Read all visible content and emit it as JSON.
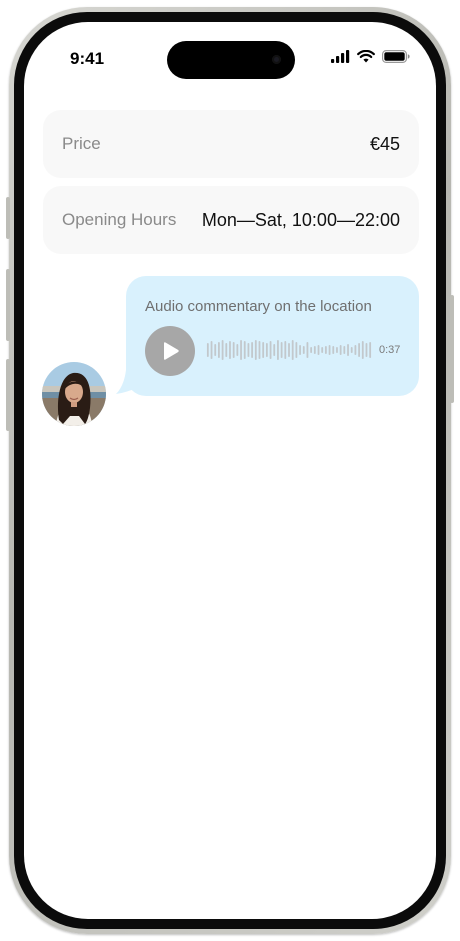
{
  "status_bar": {
    "time": "9:41"
  },
  "details": [
    {
      "label": "Price",
      "value": "€45"
    },
    {
      "label": "Opening Hours",
      "value": "Mon—Sat, 10:00—22:00"
    }
  ],
  "message": {
    "title": "Audio commentary on the location",
    "duration": "0:37",
    "playback_progress": 0,
    "bubble_color": "#d9f1fd"
  },
  "icons": {
    "signal": "cellular-signal-icon",
    "wifi": "wifi-icon",
    "battery": "battery-icon",
    "play": "play-icon"
  }
}
